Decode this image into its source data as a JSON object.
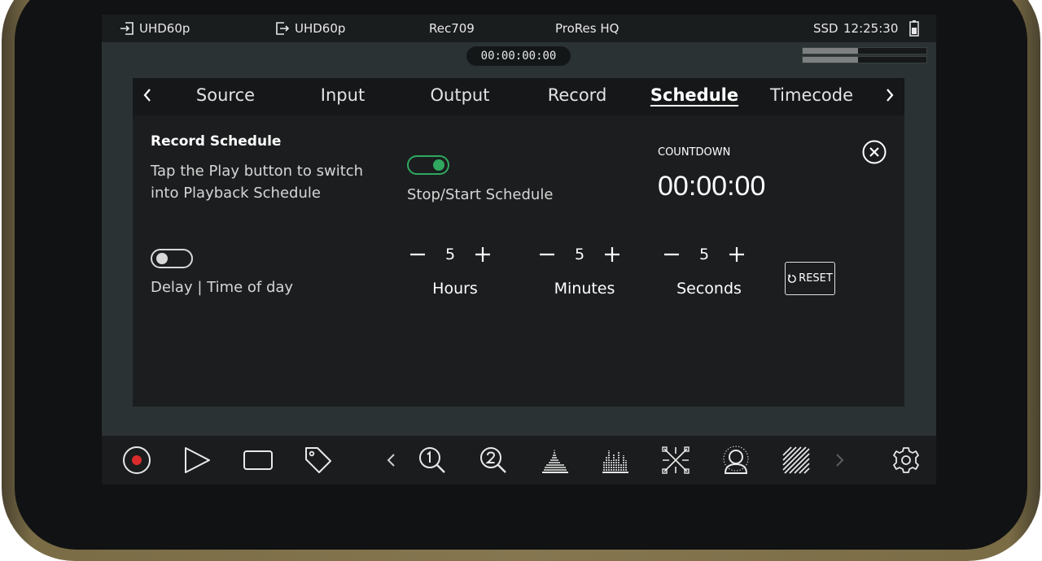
{
  "status_bar": {
    "input_format": "UHD60p",
    "output_format": "UHD60p",
    "color_space": "Rec709",
    "codec": "ProRes HQ",
    "media": "SSD",
    "clock": "12:25:30"
  },
  "timecode_display": "00:00:00:00",
  "audio_meters": [
    0.45,
    0.45
  ],
  "tabs": {
    "items": [
      "Source",
      "Input",
      "Output",
      "Record",
      "Schedule",
      "Timecode"
    ],
    "active": "Schedule"
  },
  "schedule": {
    "heading": "Record Schedule",
    "description_line1": "Tap the Play button to switch",
    "description_line2": "into Playback Schedule",
    "schedule_toggle_on": true,
    "schedule_toggle_label": "Stop/Start Schedule",
    "countdown_label": "COUNTDOWN",
    "countdown_value": "00:00:00",
    "delay_toggle_on": false,
    "delay_toggle_label": "Delay | Time of day",
    "hours_value": "5",
    "hours_label": "Hours",
    "minutes_value": "5",
    "minutes_label": "Minutes",
    "seconds_value": "5",
    "seconds_label": "Seconds",
    "reset_label": "RESET"
  },
  "toolbar_icons": [
    "record-icon",
    "play-icon",
    "frame-icon",
    "tag-icon",
    "chevron-left-icon",
    "zoom-1-icon",
    "zoom-2-icon",
    "waveform-icon",
    "histogram-icon",
    "vectorscope-icon",
    "skin-tone-icon",
    "zebra-icon",
    "chevron-right-icon",
    "gear-icon"
  ],
  "colors": {
    "accent_green": "#2fa960",
    "record_red": "#d92b2b",
    "bezel": "#857650"
  }
}
